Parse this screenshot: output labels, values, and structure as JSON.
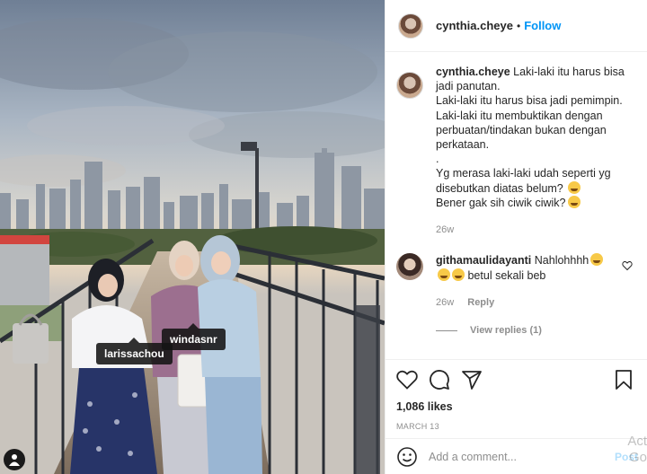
{
  "post": {
    "username": "cynthia.cheye",
    "follow_label": "Follow",
    "caption_lines": [
      "Laki-laki itu harus bisa",
      "jadi panutan.",
      "Laki-laki itu harus bisa jadi pemimpin.",
      "Laki-laki itu membuktikan dengan",
      "perbuatan/tindakan bukan dengan",
      "perkataan.",
      ".",
      "Yg merasa laki-laki udah seperti yg",
      "disebutkan diatas belum?",
      "Bener gak sih ciwik ciwik?"
    ],
    "caption_age": "26w",
    "likes": "1,086 likes",
    "date": "MARCH 13"
  },
  "photo": {
    "tags": [
      "windasnr",
      "larissachou"
    ]
  },
  "comment": {
    "username": "githamaulidayanti",
    "text_1": "Nahlohhhh",
    "text_2": "betul sekali beb",
    "age": "26w",
    "reply_label": "Reply",
    "view_replies": "View replies (1)"
  },
  "add_comment": {
    "placeholder": "Add a comment...",
    "post_label": "Post"
  },
  "watermark": [
    "Act",
    "Go"
  ],
  "colors": {
    "accent": "#0095f6",
    "muted": "#8e8e8e",
    "post_disabled": "#b2dffc"
  },
  "icons": [
    "heart-icon",
    "comment-icon",
    "share-icon",
    "bookmark-icon",
    "emoji-icon",
    "user-tag-icon"
  ]
}
